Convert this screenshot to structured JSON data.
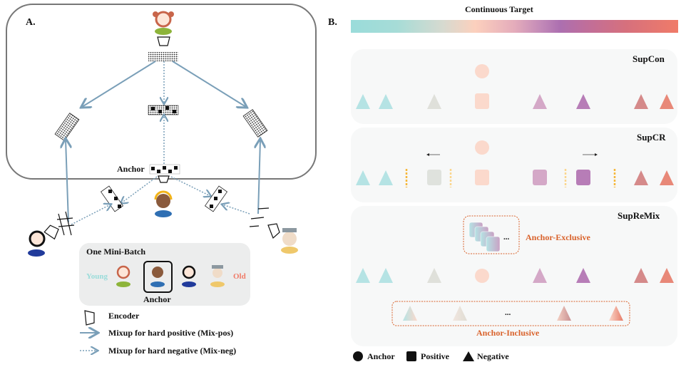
{
  "panel_a": {
    "label": "A.",
    "anchor_label": "Anchor",
    "minibatch": {
      "title": "One Mini-Batch",
      "young_label": "Young",
      "old_label": "Old",
      "anchor_caption": "Anchor",
      "young_color": "#9adcda",
      "old_color": "#f07b68"
    },
    "legend": {
      "encoder": "Encoder",
      "mix_pos": "Mixup for hard positive (Mix-pos)",
      "mix_neg": "Mixup for hard negative (Mix-neg)"
    },
    "arrow_color": "#7a9fb8"
  },
  "panel_b": {
    "label": "B.",
    "gradient_title": "Continuous Target",
    "rows": [
      {
        "title": "SupCon"
      },
      {
        "title": "SupCR"
      },
      {
        "title": "SupReMix",
        "exclusive_label": "Anchor-Exclusive",
        "inclusive_label": "Anchor-Inclusive",
        "ellipsis": "..."
      }
    ],
    "legend": {
      "anchor": "Anchor",
      "positive": "Positive",
      "negative": "Negative"
    },
    "accent_color": "#d9622b",
    "boundary_color": "#f5b73b"
  }
}
